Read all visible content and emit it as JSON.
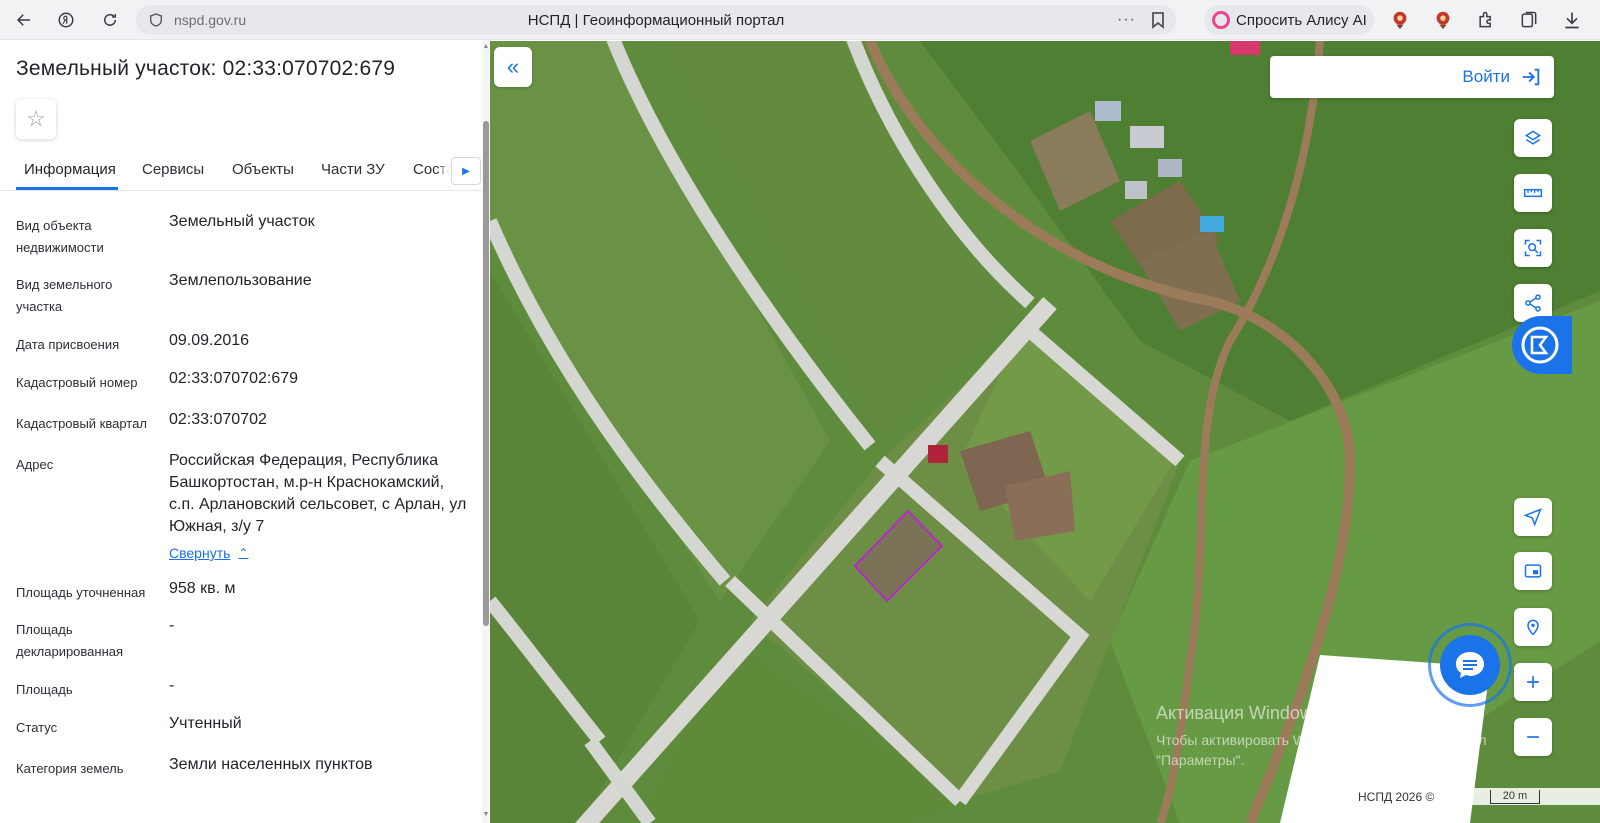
{
  "browser": {
    "url": "nspd.gov.ru",
    "page_title": "НСПД | Геоинформационный портал",
    "alice_label": "Спросить Алису AI"
  },
  "panel": {
    "title": "Земельный участок: 02:33:070702:679",
    "tabs": [
      "Информация",
      "Сервисы",
      "Объекты",
      "Части ЗУ",
      "Соста"
    ],
    "active_tab": "Информация",
    "properties": [
      {
        "label": "Вид объекта недвижимости",
        "value": "Земельный участок"
      },
      {
        "label": "Вид земельного участка",
        "value": "Землепользование"
      },
      {
        "label": "Дата присвоения",
        "value": "09.09.2016"
      },
      {
        "label": "Кадастровый номер",
        "value": "02:33:070702:679"
      },
      {
        "label": "Кадастровый квартал",
        "value": "02:33:070702"
      },
      {
        "label": "Адрес",
        "value": "Российская Федерация, Республика Башкортостан, м.р-н Краснокамский, с.п. Арлановский сельсовет, с Арлан, ул Южная, з/у 7"
      },
      {
        "label": "Площадь уточненная",
        "value": "958 кв. м"
      },
      {
        "label": "Площадь декларированная",
        "value": "-"
      },
      {
        "label": "Площадь",
        "value": "-"
      },
      {
        "label": "Статус",
        "value": "Учтенный"
      },
      {
        "label": "Категория земель",
        "value": "Земли населенных пунктов"
      }
    ],
    "collapse_link": "Свернуть"
  },
  "map": {
    "login_label": "Войти",
    "watermark_title": "Активация Windows",
    "watermark_text_1": "Чтобы активировать Windows, перейдите в раздел",
    "watermark_text_2": "\"Параметры\".",
    "attribution": "НСПД 2026 ©",
    "scale_label": "20 m",
    "icons": [
      "layers-icon",
      "ruler-icon",
      "area-select-icon",
      "share-icon",
      "locate-icon",
      "minimap-icon",
      "geo-search-icon",
      "zoom-in-icon",
      "zoom-out-icon",
      "chat-icon"
    ]
  }
}
